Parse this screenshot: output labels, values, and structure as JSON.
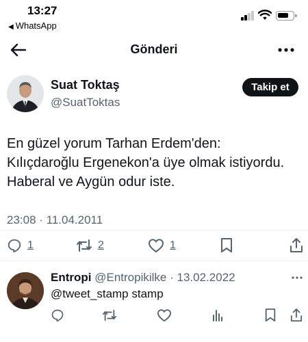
{
  "status_bar": {
    "time": "13:27",
    "back_app": "WhatsApp",
    "signal_bars_active": 2,
    "signal_bars_total": 4
  },
  "nav": {
    "title": "Gönderi",
    "back_icon": "arrow-left-icon",
    "more_icon": "more-horizontal-icon"
  },
  "tweet": {
    "author_name": "Suat Toktaş",
    "author_handle": "@SuatToktas",
    "follow_label": "Takip et",
    "text_lines": [
      "En güzel yorum Tarhan Erdem'den:",
      "Kılıçdaroğlu Ergenekon'a üye olmak istiyordu.",
      "Haberal ve Aygün odur iste."
    ],
    "timestamp": "23:08 · 11.04.2011",
    "actions": {
      "reply_count": "1",
      "retweet_count": "2",
      "like_count": "1"
    }
  },
  "reply": {
    "author_name": "Entropi",
    "author_handle": "@Entropikilke",
    "separator": "·",
    "date": "13.02.2022",
    "text": "@tweet_stamp stamp"
  },
  "colors": {
    "text_primary": "#0f1419",
    "text_secondary": "#536471",
    "divider": "#eff3f4",
    "follow_button": "#0f1419"
  }
}
